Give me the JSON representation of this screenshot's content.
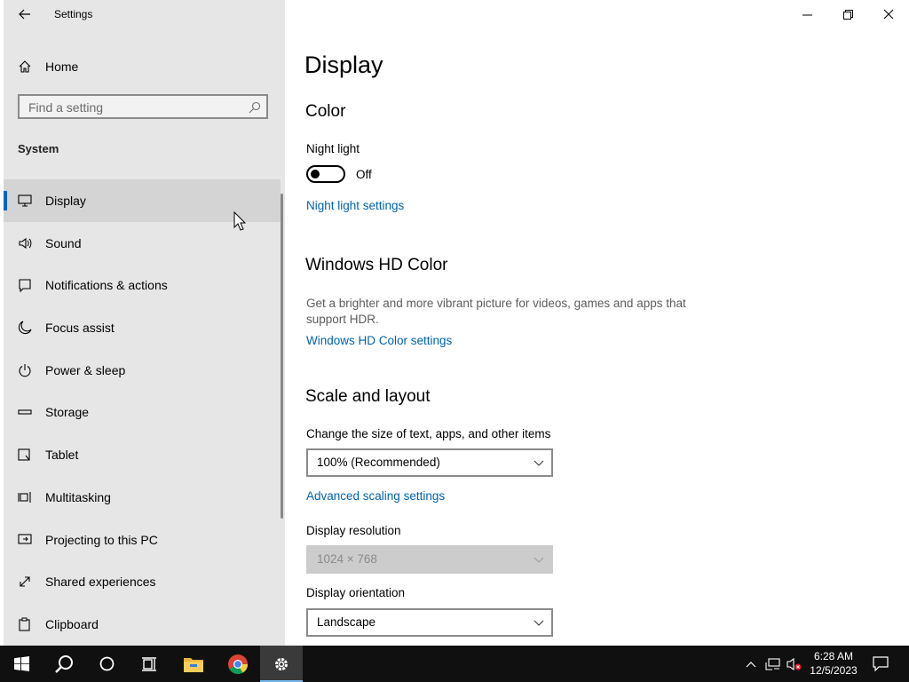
{
  "app": {
    "title": "Settings"
  },
  "sidebar": {
    "home_label": "Home",
    "search_placeholder": "Find a setting",
    "section_label": "System",
    "items": [
      {
        "label": "Display",
        "icon": "monitor-icon",
        "active": true
      },
      {
        "label": "Sound",
        "icon": "speaker-icon"
      },
      {
        "label": "Notifications & actions",
        "icon": "notification-icon"
      },
      {
        "label": "Focus assist",
        "icon": "moon-icon"
      },
      {
        "label": "Power & sleep",
        "icon": "power-icon"
      },
      {
        "label": "Storage",
        "icon": "storage-icon"
      },
      {
        "label": "Tablet",
        "icon": "tablet-icon"
      },
      {
        "label": "Multitasking",
        "icon": "multitasking-icon"
      },
      {
        "label": "Projecting to this PC",
        "icon": "projecting-icon"
      },
      {
        "label": "Shared experiences",
        "icon": "shared-experiences-icon"
      },
      {
        "label": "Clipboard",
        "icon": "clipboard-icon"
      }
    ]
  },
  "main": {
    "page_title": "Display",
    "color": {
      "heading": "Color",
      "night_light_label": "Night light",
      "night_light_state": "Off",
      "night_light_link": "Night light settings"
    },
    "hdr": {
      "heading": "Windows HD Color",
      "description": "Get a brighter and more vibrant picture for videos, games and apps that support HDR.",
      "link": "Windows HD Color settings"
    },
    "scale": {
      "heading": "Scale and layout",
      "size_label": "Change the size of text, apps, and other items",
      "size_value": "100% (Recommended)",
      "advanced_link": "Advanced scaling settings",
      "resolution_label": "Display resolution",
      "resolution_value": "1024 × 768",
      "orientation_label": "Display orientation",
      "orientation_value": "Landscape"
    }
  },
  "taskbar": {
    "time": "6:28 AM",
    "date": "12/5/2023"
  },
  "colors": {
    "accent": "#0067c0",
    "link": "#0063b1",
    "sidebar_bg": "#e6e6e6",
    "taskbar_bg": "#101010"
  }
}
